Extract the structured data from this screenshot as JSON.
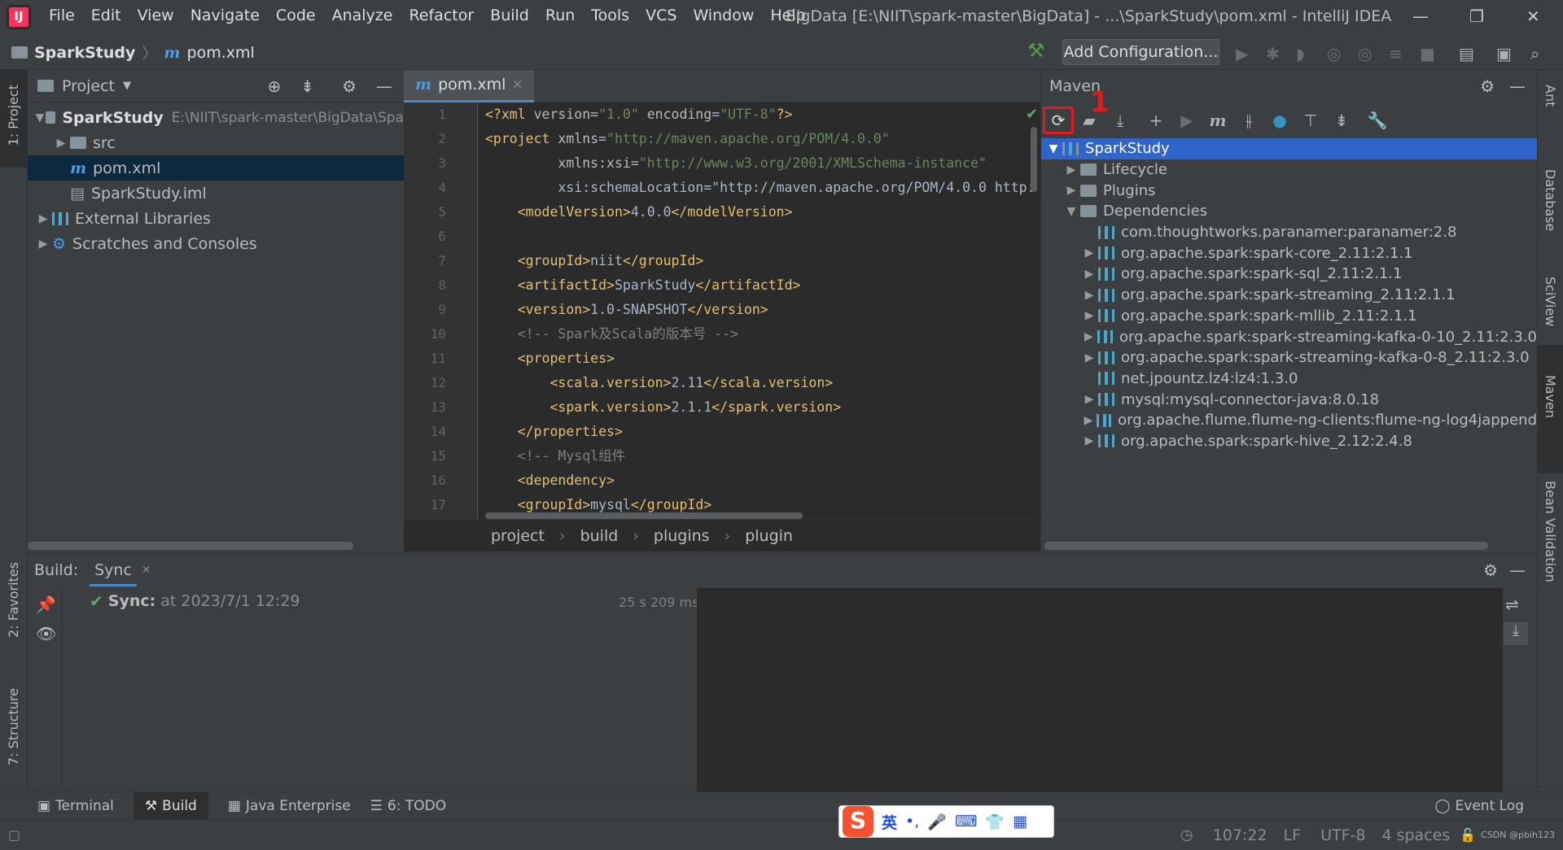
{
  "menubar": {
    "items": [
      "File",
      "Edit",
      "View",
      "Navigate",
      "Code",
      "Analyze",
      "Refactor",
      "Build",
      "Run",
      "Tools",
      "VCS",
      "Window",
      "Help"
    ],
    "window_title": "BigData [E:\\NIIT\\spark-master\\BigData] - ...\\SparkStudy\\pom.xml - IntelliJ IDEA"
  },
  "navbar": {
    "project": "SparkStudy",
    "file": "pom.xml",
    "add_configuration": "Add Configuration..."
  },
  "left_tabs": {
    "project": "1: Project",
    "favorites": "2: Favorites",
    "structure": "7: Structure"
  },
  "project_panel": {
    "title": "Project",
    "tree": [
      {
        "label": "SparkStudy",
        "path": "E:\\NIIT\\spark-master\\BigData\\Spa",
        "depth": 0,
        "expanded": true,
        "kind": "module"
      },
      {
        "label": "src",
        "depth": 1,
        "expanded": false,
        "kind": "folder"
      },
      {
        "label": "pom.xml",
        "depth": 1,
        "kind": "maven",
        "selected": true
      },
      {
        "label": "SparkStudy.iml",
        "depth": 1,
        "kind": "file"
      },
      {
        "label": "External Libraries",
        "depth": 0,
        "expanded": false,
        "kind": "lib"
      },
      {
        "label": "Scratches and Consoles",
        "depth": 0,
        "expanded": false,
        "kind": "scratch"
      }
    ]
  },
  "editor": {
    "tab": "pom.xml",
    "line_numbers": [
      "1",
      "2",
      "3",
      "4",
      "5",
      "6",
      "7",
      "8",
      "9",
      "10",
      "11",
      "12",
      "13",
      "14",
      "15",
      "16",
      "17"
    ],
    "lines": [
      "<?xml version=\"1.0\" encoding=\"UTF-8\"?>",
      "<project xmlns=\"http://maven.apache.org/POM/4.0.0\"",
      "         xmlns:xsi=\"http://www.w3.org/2001/XMLSchema-instance\"",
      "         xsi:schemaLocation=\"http://maven.apache.org/POM/4.0.0 http:",
      "    <modelVersion>4.0.0</modelVersion>",
      "",
      "    <groupId>niit</groupId>",
      "    <artifactId>SparkStudy</artifactId>",
      "    <version>1.0-SNAPSHOT</version>",
      "    <!-- Spark及Scala的版本号 -->",
      "    <properties>",
      "        <scala.version>2.11</scala.version>",
      "        <spark.version>2.1.1</spark.version>",
      "    </properties>",
      "    <!-- Mysql组件",
      "    <dependency>",
      "    <groupId>mysql</groupId>"
    ],
    "breadcrumbs": [
      "project",
      "build",
      "plugins",
      "plugin"
    ]
  },
  "maven": {
    "title": "Maven",
    "annotation": "1",
    "tree": [
      {
        "label": "SparkStudy",
        "depth": 0,
        "expanded": true,
        "selected": true,
        "kind": "project"
      },
      {
        "label": "Lifecycle",
        "depth": 1,
        "expanded": false,
        "kind": "folder"
      },
      {
        "label": "Plugins",
        "depth": 1,
        "expanded": false,
        "kind": "folder"
      },
      {
        "label": "Dependencies",
        "depth": 1,
        "expanded": true,
        "kind": "folder"
      },
      {
        "label": "com.thoughtworks.paranamer:paranamer:2.8",
        "depth": 2,
        "leaf": true,
        "kind": "dep"
      },
      {
        "label": "org.apache.spark:spark-core_2.11:2.1.1",
        "depth": 2,
        "expanded": false,
        "kind": "dep"
      },
      {
        "label": "org.apache.spark:spark-sql_2.11:2.1.1",
        "depth": 2,
        "expanded": false,
        "kind": "dep"
      },
      {
        "label": "org.apache.spark:spark-streaming_2.11:2.1.1",
        "depth": 2,
        "expanded": false,
        "kind": "dep"
      },
      {
        "label": "org.apache.spark:spark-mllib_2.11:2.1.1",
        "depth": 2,
        "expanded": false,
        "kind": "dep"
      },
      {
        "label": "org.apache.spark:spark-streaming-kafka-0-10_2.11:2.3.0",
        "depth": 2,
        "expanded": false,
        "kind": "dep"
      },
      {
        "label": "org.apache.spark:spark-streaming-kafka-0-8_2.11:2.3.0",
        "depth": 2,
        "expanded": false,
        "kind": "dep"
      },
      {
        "label": "net.jpountz.lz4:lz4:1.3.0",
        "depth": 2,
        "leaf": true,
        "kind": "dep"
      },
      {
        "label": "mysql:mysql-connector-java:8.0.18",
        "depth": 2,
        "expanded": false,
        "kind": "dep"
      },
      {
        "label": "org.apache.flume.flume-ng-clients:flume-ng-log4jappend",
        "depth": 2,
        "expanded": false,
        "kind": "dep"
      },
      {
        "label": "org.apache.spark:spark-hive_2.12:2.4.8",
        "depth": 2,
        "expanded": false,
        "kind": "dep"
      }
    ]
  },
  "right_tabs": [
    "Ant",
    "Database",
    "SciView",
    "Maven",
    "Bean Validation"
  ],
  "build": {
    "label": "Build:",
    "tab": "Sync",
    "sync_label": "Sync:",
    "sync_time": "at 2023/7/1 12:29",
    "duration": "25 s 209 ms"
  },
  "bottom_tabs": [
    "Terminal",
    "Build",
    "Java Enterprise",
    "6: TODO"
  ],
  "event_log": "Event Log",
  "status": {
    "position": "107:22",
    "line_sep": "LF",
    "encoding": "UTF-8",
    "indent": "4 spaces",
    "watermark": "CSDN @pbih123"
  },
  "ime": {
    "lang": "英",
    "punct": "•,"
  },
  "colors": {
    "accent": "#4a88c7",
    "selection": "#2f65ca",
    "annotation_red": "#e01b1b",
    "bg": "#3c3f41",
    "editor_bg": "#2b2b2b"
  }
}
